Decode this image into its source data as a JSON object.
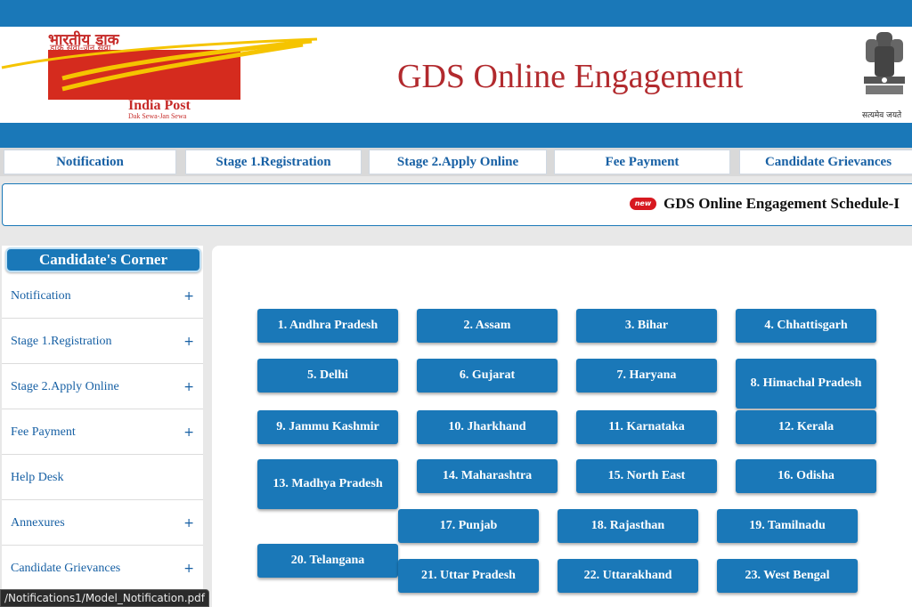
{
  "header": {
    "logo": {
      "hindi": "भारतीय डाक",
      "hindi_tagline": "डाक सेवा-जन सेवा",
      "name": "India Post",
      "tagline": "Dak Sewa-Jan Sewa"
    },
    "title": "GDS Online Engagement",
    "emblem_caption": "सत्यमेव जयते"
  },
  "nav": {
    "items": [
      "Notification",
      "Stage 1.Registration",
      "Stage 2.Apply Online",
      "Fee Payment",
      "Candidate Grievances"
    ]
  },
  "marquee": {
    "badge": "new",
    "text": "GDS Online Engagement Schedule-I"
  },
  "sidebar": {
    "title": "Candidate's Corner",
    "items": [
      {
        "label": "Notification",
        "expand": "+"
      },
      {
        "label": "Stage 1.Registration",
        "expand": "+"
      },
      {
        "label": "Stage 2.Apply Online",
        "expand": "+"
      },
      {
        "label": "Fee Payment",
        "expand": "+"
      },
      {
        "label": "Help Desk",
        "expand": ""
      },
      {
        "label": "Annexures",
        "expand": "+"
      },
      {
        "label": "Candidate Grievances",
        "expand": "+"
      }
    ]
  },
  "states": [
    "1. Andhra Pradesh",
    "2. Assam",
    "3. Bihar",
    "4. Chhattisgarh",
    "5. Delhi",
    "6. Gujarat",
    "7. Haryana",
    "8. Himachal Pradesh",
    "9. Jammu Kashmir",
    "10. Jharkhand",
    "11. Karnataka",
    "12. Kerala",
    "13. Madhya Pradesh",
    "14. Maharashtra",
    "15. North East",
    "16. Odisha",
    "17. Punjab",
    "18. Rajasthan",
    "19. Tamilnadu",
    "20. Telangana",
    "21. Uttar Pradesh",
    "22. Uttarakhand",
    "23. West Bengal"
  ],
  "statusbar": {
    "url": "/Notifications1/Model_Notification.pdf"
  },
  "colors": {
    "primary_blue": "#1a78b8",
    "title_red": "#b22a2e",
    "logo_red": "#d52b1e",
    "logo_yellow": "#f5c400"
  }
}
